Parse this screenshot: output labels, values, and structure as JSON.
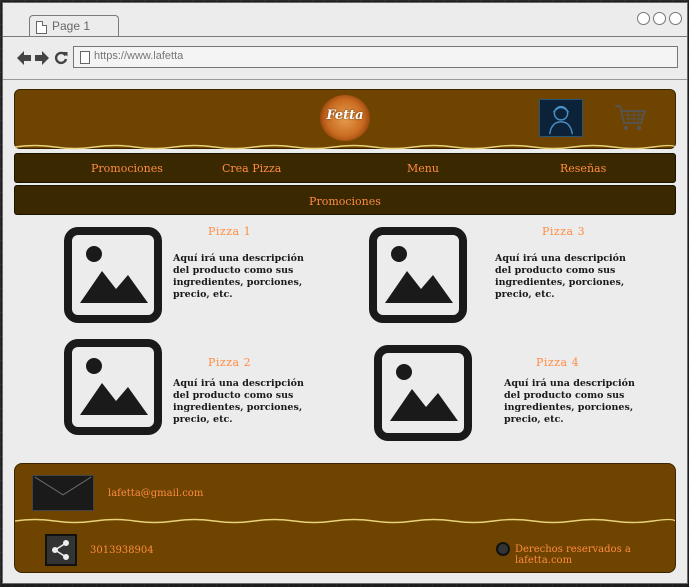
{
  "browser": {
    "tab_title": "Page 1",
    "url": "https://www.lafetta"
  },
  "header": {
    "logo_text": "Fetta"
  },
  "menu": {
    "items": [
      "Promociones",
      "Crea Pizza",
      "Menu",
      "Reseñas"
    ]
  },
  "subheader": {
    "label": "Promociones"
  },
  "products": [
    {
      "title": "Pizza 1",
      "description": "Aquí irá una descripción del producto como sus ingredientes, porciones, precio, etc."
    },
    {
      "title": "Pizza 3",
      "description": "Aquí irá una descripción del producto como sus ingredientes, porciones, precio, etc."
    },
    {
      "title": "Pizza 2",
      "description": "Aquí irá una descripción del producto como sus ingredientes, porciones, precio, etc."
    },
    {
      "title": "Pizza 4",
      "description": "Aquí irá una descripción del producto como sus ingredientes, porciones, precio, etc."
    }
  ],
  "footer": {
    "email": "lafetta@gmail.com",
    "phone": "3013938904",
    "copyright": "Derechos reservados a lafetta.com"
  },
  "colors": {
    "brown": "#6e4400",
    "dark_brown": "#3a2800",
    "accent_orange": "#ff8c42"
  },
  "icons": {
    "back": "arrow-left-icon",
    "forward": "arrow-right-icon",
    "reload": "reload-icon",
    "user": "user-avatar-icon",
    "cart": "shopping-cart-icon",
    "image_placeholder": "image-placeholder-icon",
    "mail": "mail-icon",
    "share": "share-icon",
    "copyright": "copyright-icon"
  }
}
